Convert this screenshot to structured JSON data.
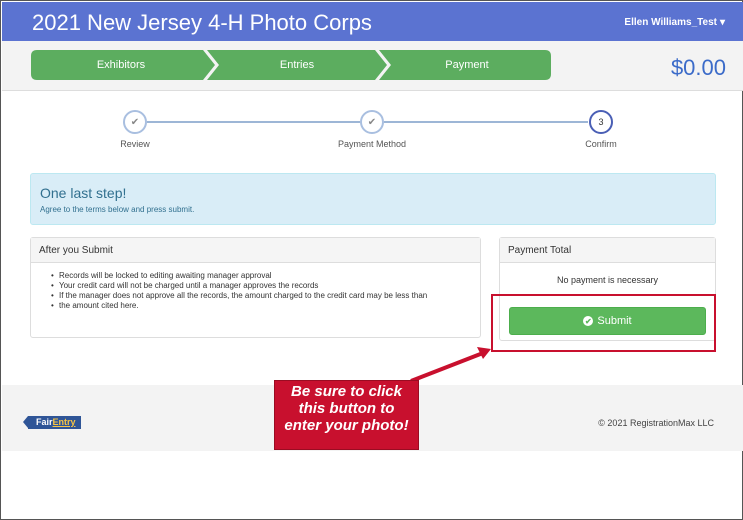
{
  "header": {
    "title": "2021 New Jersey 4-H Photo Corps",
    "user": "Ellen Williams_Test",
    "user_caret": "▾"
  },
  "breadcrumb": {
    "items": [
      "Exhibitors",
      "Entries",
      "Payment"
    ],
    "total": "$0.00",
    "color": "#5cad5f"
  },
  "stepper": {
    "steps": [
      {
        "label": "Review",
        "mark": "✔",
        "state": "done"
      },
      {
        "label": "Payment Method",
        "mark": "✔",
        "state": "done"
      },
      {
        "label": "Confirm",
        "mark": "3",
        "state": "active"
      }
    ]
  },
  "alert": {
    "heading": "One last step!",
    "text": "Agree to the terms below and press submit."
  },
  "after_submit": {
    "title": "After you Submit",
    "items": [
      "Records will be locked to editing awaiting manager approval",
      "Your credit card will not be charged until a manager approves the records",
      "If the manager does not approve all the records, the amount charged to the credit card may be less than",
      "the amount cited here."
    ]
  },
  "payment_total": {
    "title": "Payment Total",
    "message": "No payment is necessary",
    "submit_label": "Submit",
    "submit_icon": "✔"
  },
  "callout": {
    "lines": [
      "Be sure to click",
      "this button to",
      "enter your photo!"
    ],
    "color": "#c8102e"
  },
  "footer": {
    "logo_a": "Fair",
    "logo_b": "Entry",
    "copyright": "© 2021 RegistrationMax LLC"
  }
}
